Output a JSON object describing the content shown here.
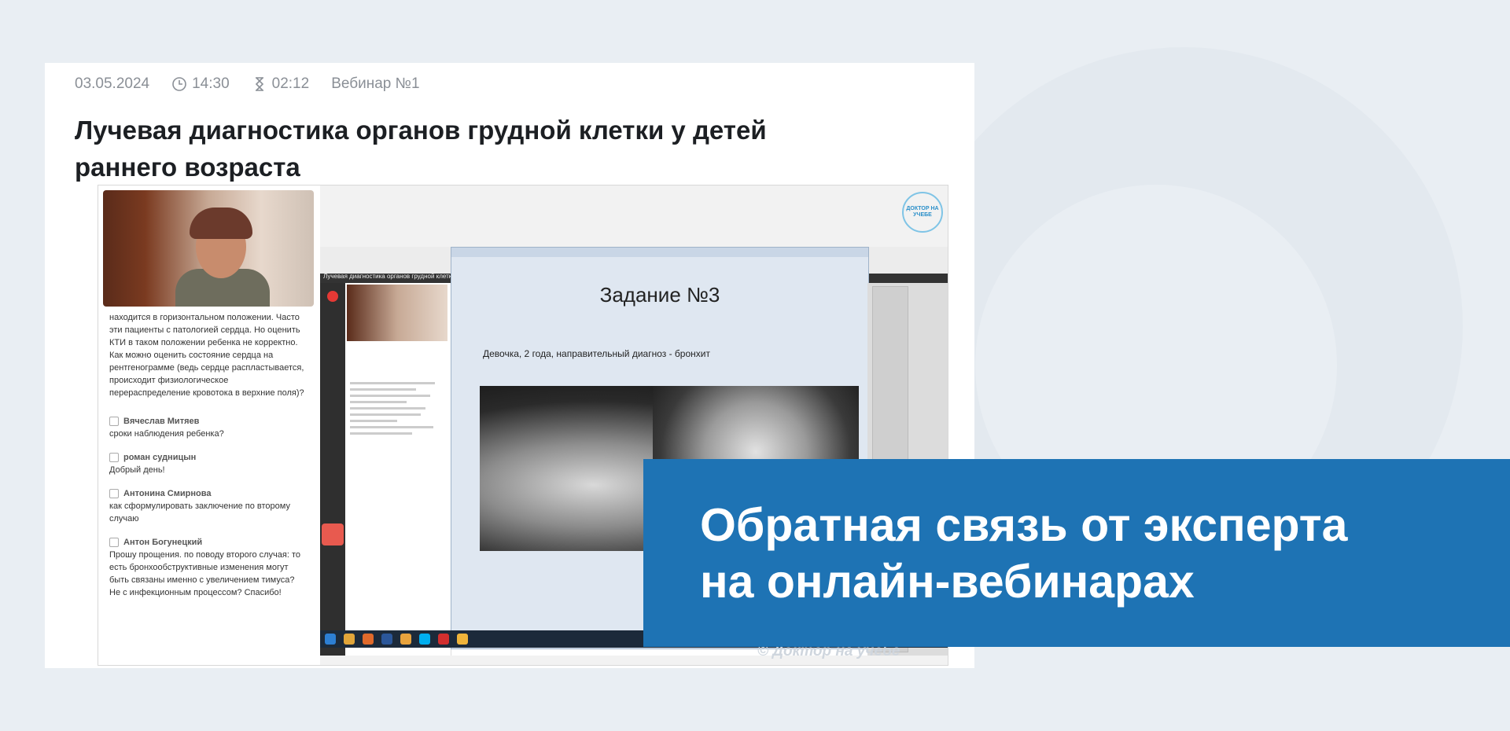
{
  "meta": {
    "date": "03.05.2024",
    "time": "14:30",
    "duration": "02:12",
    "webinar": "Вебинар №1"
  },
  "title": "Лучевая диагностика органов грудной клетки у детей раннего возраста",
  "video": {
    "chat_question": "находится в горизонтальном положении. Часто эти пациенты с патологией сердца. Но оценить КТИ в таком положении ребенка не корректно. Как можно оценить состояние сердца на рентгенограмме (ведь сердце распластывается, происходит физиологическое перераспределение кровотока в верхние поля)?",
    "messages": [
      {
        "author": "Вячеслав Митяев",
        "text": "сроки наблюдения ребенка?"
      },
      {
        "author": "роман судницын",
        "text": "Добрый день!"
      },
      {
        "author": "Антонина Смирнова",
        "text": "как сформулировать заключение по второму случаю"
      },
      {
        "author": "Антон Богунецкий",
        "text": "Прошу прощения. по поводу второго случая: то есть бронхообструктивные изменения могут быть связаны именно с увеличением тимуса? Не с инфекционным процессом? Спасибо!"
      }
    ],
    "inner_page_title": "Лучевая диагностика органов грудной клетки у детей раннего возраста",
    "slide_heading": "Задание №3",
    "slide_subtitle": "Девочка, 2 года, направительный диагноз - бронхит",
    "logo_text": "ДОКТОР НА УЧЕБЕ",
    "watermark": "© Доктор на учебе"
  },
  "banner": {
    "line1": "Обратная связь от эксперта",
    "line2": "на онлайн-вебинарах",
    "color": "#1e73b4"
  }
}
